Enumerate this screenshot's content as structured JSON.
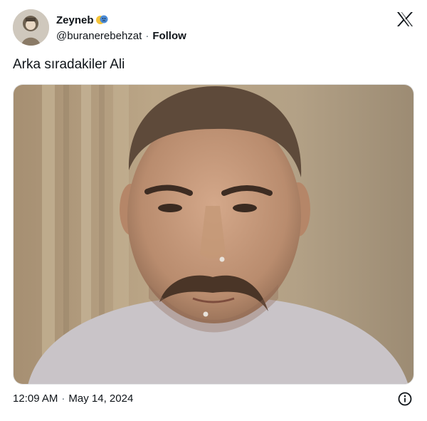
{
  "author": {
    "display_name": "Zeyneb",
    "name_emoji": "performing-arts-emoji-icon",
    "handle": "@buranerebehzat",
    "separator": "·",
    "follow_label": "Follow"
  },
  "tweet": {
    "text": "Arka sıradakiler Ali",
    "time": "12:09 AM",
    "date_separator": "·",
    "date": "May 14, 2024"
  },
  "icons": {
    "brand": "x-logo-icon",
    "info": "info-icon"
  },
  "colors": {
    "text": "#0f1419",
    "secondary": "#536471"
  }
}
